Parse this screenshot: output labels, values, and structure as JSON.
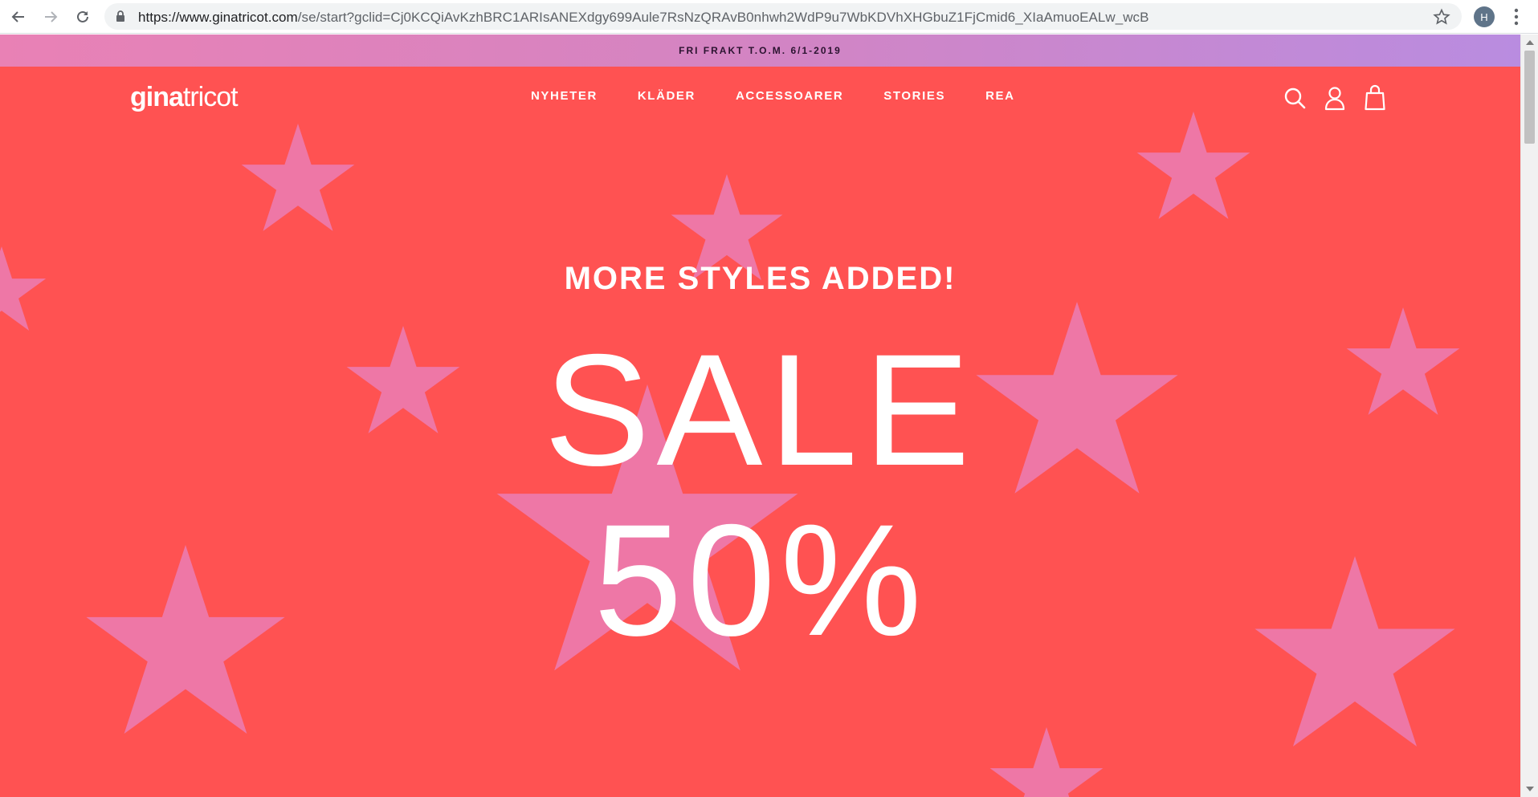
{
  "browser": {
    "url_host": "https://www.ginatricot.com",
    "url_path": "/se/start?gclid=Cj0KCQiAvKzhBRC1ARIsANEXdgy699Aule7RsNzQRAvB0nhwh2WdP9u7WbKDVhXHGbuZ1FjCmid6_XIaAmuoEALw_wcB",
    "profile_initial": "H"
  },
  "promo": {
    "text": "FRI FRAKT T.O.M. 6/1-2019"
  },
  "header": {
    "logo_bold": "gina",
    "logo_light": "tricot",
    "nav": [
      "NYHETER",
      "KLÄDER",
      "ACCESSOARER",
      "STORIES",
      "REA"
    ]
  },
  "hero": {
    "tagline": "MORE STYLES ADDED!",
    "headline": "SALE",
    "discount": "50%"
  },
  "colors": {
    "hero_bg": "#ff5252",
    "star": "#ee77a6",
    "text": "#ffffff"
  }
}
